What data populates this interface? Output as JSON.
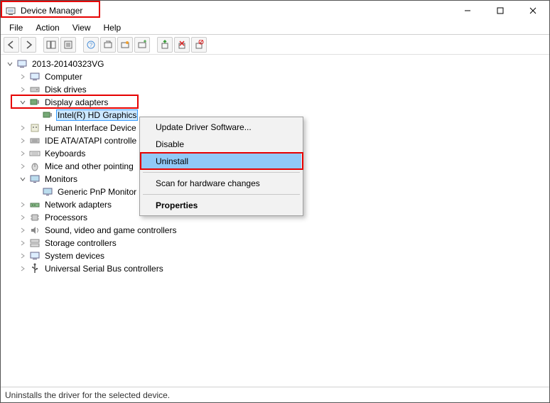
{
  "window": {
    "title": "Device Manager"
  },
  "menu": {
    "file": "File",
    "action": "Action",
    "view": "View",
    "help": "Help"
  },
  "tree": {
    "root": "2013-20140323VG",
    "computer": "Computer",
    "diskdrives": "Disk drives",
    "displayadapters": "Display adapters",
    "intelhd": "Intel(R) HD Graphics",
    "hid": "Human Interface Device",
    "ide": "IDE ATA/ATAPI controlle",
    "keyboards": "Keyboards",
    "mice": "Mice and other pointing",
    "monitors": "Monitors",
    "genericpnp": "Generic PnP Monitor",
    "network": "Network adapters",
    "processors": "Processors",
    "sound": "Sound, video and game controllers",
    "storage": "Storage controllers",
    "system": "System devices",
    "usb": "Universal Serial Bus controllers"
  },
  "context": {
    "update": "Update Driver Software...",
    "disable": "Disable",
    "uninstall": "Uninstall",
    "scan": "Scan for hardware changes",
    "properties": "Properties"
  },
  "status": {
    "text": "Uninstalls the driver for the selected device."
  }
}
